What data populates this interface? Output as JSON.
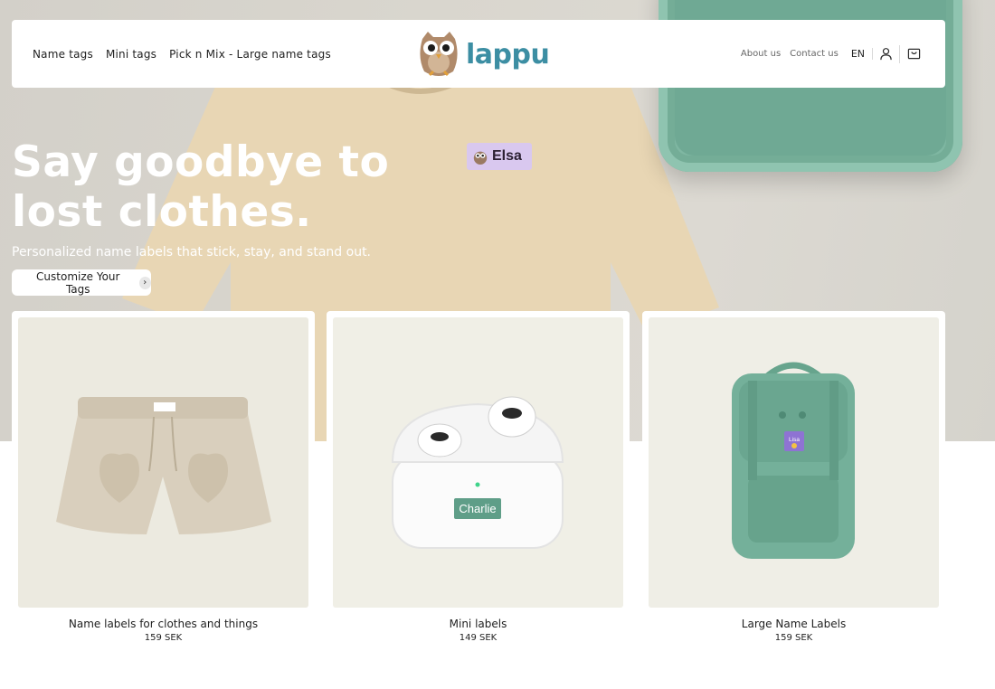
{
  "brand": {
    "name": "lappu",
    "color": "#3c8ea3"
  },
  "nav": {
    "left": [
      "Name tags",
      "Mini tags",
      "Pick n Mix - Large name tags"
    ],
    "right": [
      "About us",
      "Contact us"
    ],
    "language": "EN",
    "icons": [
      "user-icon",
      "cart-icon"
    ]
  },
  "hero": {
    "title": "Say goodbye to lost clothes.",
    "subtitle": "Personalized name labels that stick, stay, and stand out.",
    "cta_label": "Customize Your Tags",
    "shirt_tag_name": "Elsa"
  },
  "products": [
    {
      "title": "Name labels for clothes and things",
      "price": "159 SEK"
    },
    {
      "title": "Mini labels",
      "price": "149 SEK",
      "label_text": "Charlie"
    },
    {
      "title": "Large Name Labels",
      "price": "159 SEK",
      "label_text": "Lisa"
    }
  ]
}
